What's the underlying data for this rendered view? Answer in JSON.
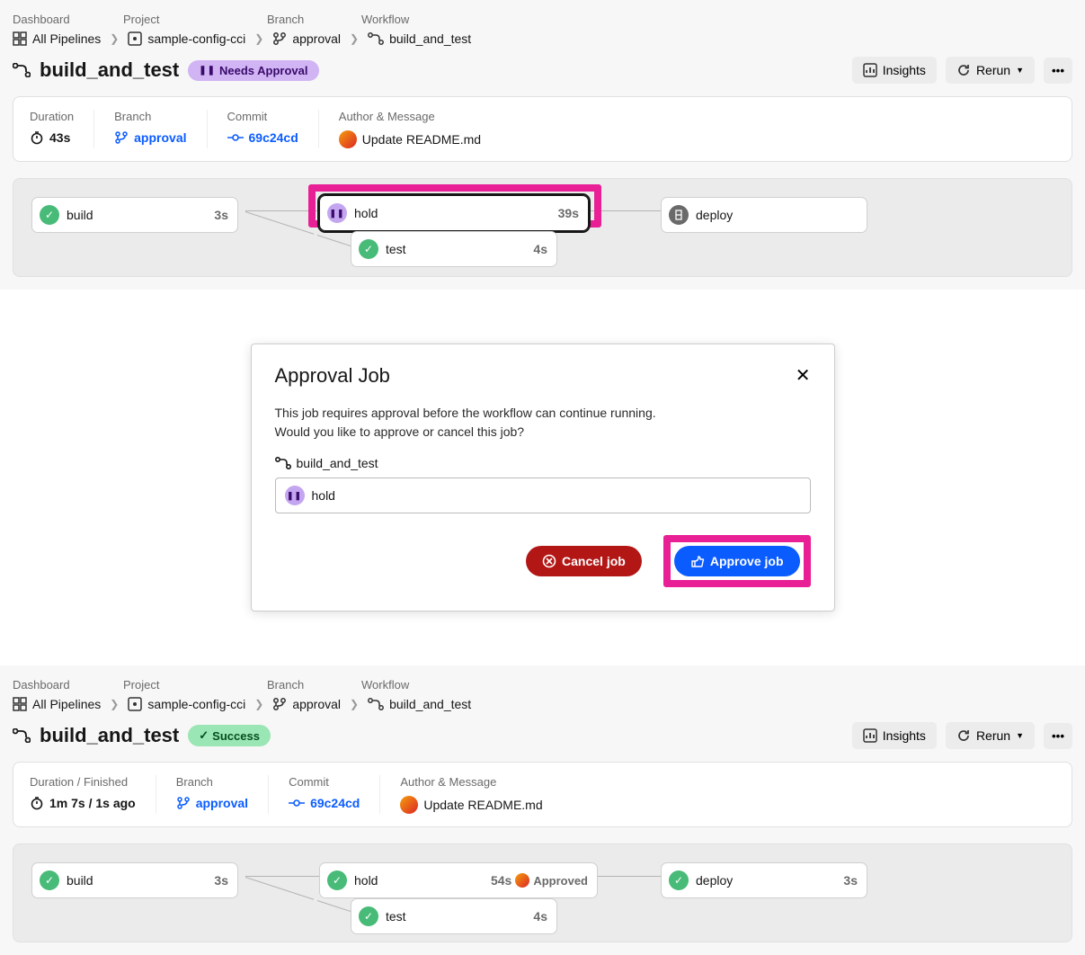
{
  "breadcrumb": {
    "headers": [
      "Dashboard",
      "Project",
      "Branch",
      "Workflow"
    ],
    "dashboard": "All Pipelines",
    "project": "sample-config-cci",
    "branch": "approval",
    "workflow": "build_and_test"
  },
  "view1": {
    "title": "build_and_test",
    "status_badge": "Needs Approval",
    "buttons": {
      "insights": "Insights",
      "rerun": "Rerun"
    },
    "info": {
      "duration_label": "Duration",
      "duration": "43s",
      "branch_label": "Branch",
      "branch": "approval",
      "commit_label": "Commit",
      "commit": "69c24cd",
      "author_label": "Author & Message",
      "message": "Update README.md"
    },
    "jobs": {
      "build": {
        "name": "build",
        "time": "3s"
      },
      "hold": {
        "name": "hold",
        "time": "39s"
      },
      "test": {
        "name": "test",
        "time": "4s"
      },
      "deploy": {
        "name": "deploy"
      }
    }
  },
  "modal": {
    "title": "Approval Job",
    "line1": "This job requires approval before the workflow can continue running.",
    "line2": "Would you like to approve or cancel this job?",
    "workflow": "build_and_test",
    "job": "hold",
    "cancel": "Cancel job",
    "approve": "Approve job"
  },
  "view2": {
    "title": "build_and_test",
    "status_badge": "Success",
    "buttons": {
      "insights": "Insights",
      "rerun": "Rerun"
    },
    "info": {
      "duration_label": "Duration / Finished",
      "duration": "1m 7s / 1s ago",
      "branch_label": "Branch",
      "branch": "approval",
      "commit_label": "Commit",
      "commit": "69c24cd",
      "author_label": "Author & Message",
      "message": "Update README.md"
    },
    "jobs": {
      "build": {
        "name": "build",
        "time": "3s"
      },
      "hold": {
        "name": "hold",
        "time": "54s",
        "approved": "Approved"
      },
      "test": {
        "name": "test",
        "time": "4s"
      },
      "deploy": {
        "name": "deploy",
        "time": "3s"
      }
    }
  }
}
